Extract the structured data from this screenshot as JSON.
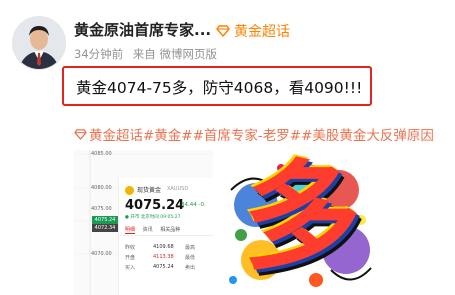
{
  "post": {
    "author": "黄金原油首席专家...",
    "topic_badge": "黄金超话",
    "time": "34分钟前",
    "source": "来自 微博网页版",
    "text": "黄金4074-75多，防守4068，看4090!!!",
    "hashtags": [
      "黄金超话",
      "#黄金##首席专家-老罗##美股黄金大反弹原因"
    ]
  },
  "screenshot_image": {
    "y_ticks": [
      "4085.00",
      "4080.00",
      "4075.00",
      "4070.00"
    ],
    "price_tags": [
      "4075.24",
      "4072.34"
    ],
    "instrument": "现货黄金",
    "symbol": "XAUUSD",
    "price": "4075.24",
    "change": "-34.44 -0.",
    "status": "● 开市 北京时间 09:05:27",
    "tabs": [
      "明细",
      "资讯",
      "相关品种"
    ],
    "rows": [
      {
        "label": "昨收",
        "value": "4109.68",
        "label2": "最高"
      },
      {
        "label": "开盘",
        "value": "4113.38",
        "label2": "最低"
      },
      {
        "label": "买入",
        "value": "4075.24",
        "label2": "卖出"
      }
    ]
  },
  "art_image": {
    "text": "多"
  },
  "colors": {
    "accent": "#ff8200",
    "highlight": "#e3231e",
    "topic": "#eb7350",
    "meta": "#939393"
  },
  "icons": [
    "avatar",
    "diamond-topic-icon",
    "gold-coin-icon"
  ]
}
